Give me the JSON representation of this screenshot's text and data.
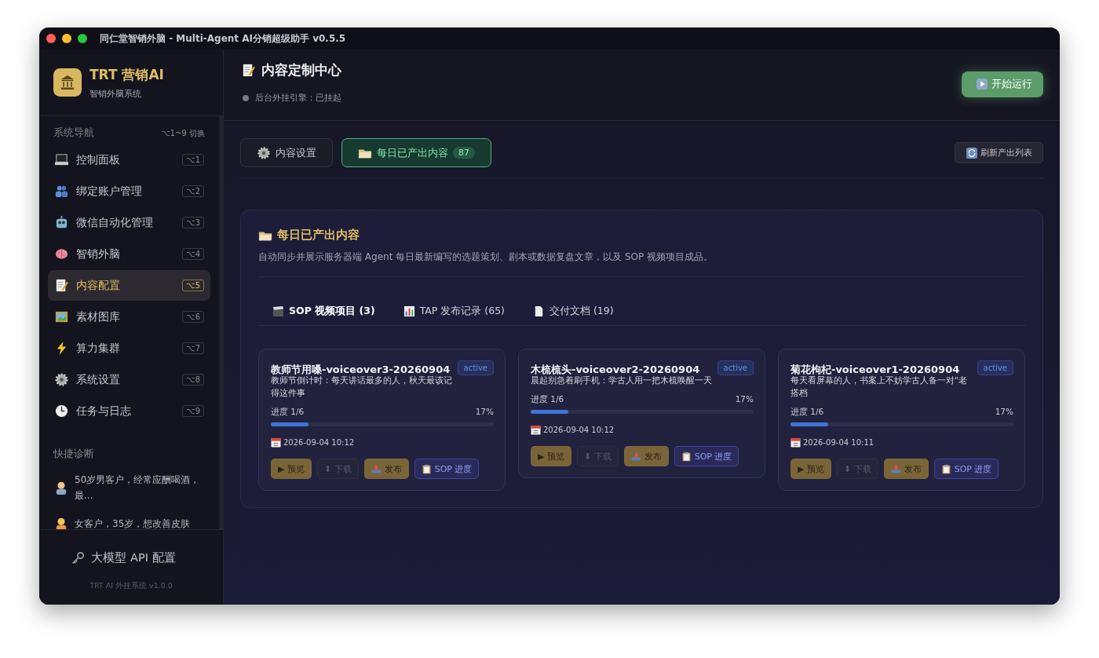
{
  "window": {
    "title": "同仁堂智销外脑 - Multi-Agent AI分销超级助手 v0.5.5"
  },
  "brand": {
    "name": "TRT 营销AI",
    "subtitle": "智销外脑系统"
  },
  "nav": {
    "heading": "系统导航",
    "hint": "⌥1~9 切换",
    "items": [
      {
        "label": "控制面板",
        "shortcut": "⌥1",
        "selected": false
      },
      {
        "label": "绑定账户管理",
        "shortcut": "⌥2",
        "selected": false
      },
      {
        "label": "微信自动化管理",
        "shortcut": "⌥3",
        "selected": false
      },
      {
        "label": "智销外脑",
        "shortcut": "⌥4",
        "selected": false
      },
      {
        "label": "内容配置",
        "shortcut": "⌥5",
        "selected": true
      },
      {
        "label": "素材图库",
        "shortcut": "⌥6",
        "selected": false
      },
      {
        "label": "算力集群",
        "shortcut": "⌥7",
        "selected": false
      },
      {
        "label": "系统设置",
        "shortcut": "⌥8",
        "selected": false
      },
      {
        "label": "任务与日志",
        "shortcut": "⌥9",
        "selected": false
      }
    ]
  },
  "diagnosis": {
    "heading": "快捷诊断",
    "items": [
      "50岁男客户，经常应酬喝酒，最...",
      "女客户，35岁，想改善皮肤"
    ]
  },
  "api_config": "大模型 API 配置",
  "version": "TRT AI 外挂系统 v1.0.0",
  "header": {
    "title": "内容定制中心",
    "status": "后台外挂引擎：已挂起",
    "run_button": "开始运行"
  },
  "tabs": [
    {
      "label": "内容设置",
      "selected": false
    },
    {
      "label": "每日已产出内容",
      "badge": "87",
      "selected": true
    }
  ],
  "refresh_button": "刷新产出列表",
  "panel": {
    "title": "每日已产出内容",
    "description": "自动同步并展示服务器端 Agent 每日最新编写的选题策划、剧本或数据复盘文章，以及 SOP 视频项目成品。",
    "subtabs": [
      {
        "label": "SOP 视频项目 (3)",
        "selected": true
      },
      {
        "label": "TAP 发布记录 (65)",
        "selected": false
      },
      {
        "label": "交付文档 (19)",
        "selected": false
      }
    ],
    "cards": [
      {
        "title": "教师节用嗓-voiceover3-20260904",
        "status": "active",
        "description": "教师节倒计时：每天讲话最多的人，秋天最该记得这件事",
        "progress_label": "进度 1/6",
        "percent": "17%",
        "level": 0.17,
        "date": "2026-09-04 10:12",
        "buttons": [
          {
            "kind": "preview",
            "label": "▶ 预览",
            "disabled": false
          },
          {
            "kind": "download",
            "label": "⬇ 下载",
            "disabled": true
          },
          {
            "kind": "publish",
            "label": "发布",
            "disabled": false
          },
          {
            "kind": "sop",
            "label": "SOP 进度",
            "disabled": false
          }
        ]
      },
      {
        "title": "木梳梳头-voiceover2-20260904",
        "status": "active",
        "description": "晨起别急着刷手机：学古人用一把木梳唤醒一天",
        "progress_label": "进度 1/6",
        "percent": "17%",
        "level": 0.17,
        "date": "2026-09-04 10:12",
        "buttons": [
          {
            "kind": "preview",
            "label": "▶ 预览",
            "disabled": false
          },
          {
            "kind": "download",
            "label": "⬇ 下载",
            "disabled": true
          },
          {
            "kind": "publish",
            "label": "发布",
            "disabled": false
          },
          {
            "kind": "sop",
            "label": "SOP 进度",
            "disabled": false
          }
        ]
      },
      {
        "title": "菊花枸杞-voiceover1-20260904",
        "status": "active",
        "description": "每天看屏幕的人，书案上不妨学古人备一对\"老搭档",
        "progress_label": "进度 1/6",
        "percent": "17%",
        "level": 0.17,
        "date": "2026-09-04 10:11",
        "buttons": [
          {
            "kind": "preview",
            "label": "▶ 预览",
            "disabled": false
          },
          {
            "kind": "download",
            "label": "⬇ 下载",
            "disabled": true
          },
          {
            "kind": "publish",
            "label": "发布",
            "disabled": false
          },
          {
            "kind": "sop",
            "label": "SOP 进度",
            "disabled": false
          }
        ]
      }
    ]
  }
}
